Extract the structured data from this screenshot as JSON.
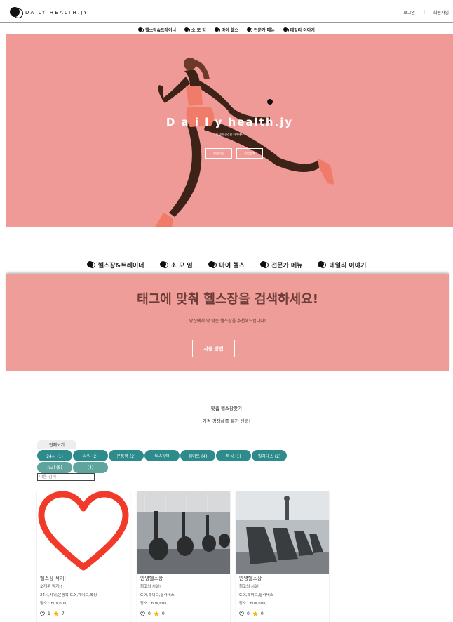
{
  "header": {
    "logo_text": "DAILY HEALTH.JY",
    "login": "로그인",
    "separator": "|",
    "signup": "회원가입"
  },
  "nav": {
    "items": [
      {
        "label": "헬스장&트레이너"
      },
      {
        "label": "소 모 임"
      },
      {
        "label": "마이 헬스"
      },
      {
        "label": "전문가 메뉴"
      },
      {
        "label": "데일리 이야기"
      }
    ]
  },
  "hero": {
    "title": "D a i l y health.jy",
    "subtitle": "일상에 건강을 더하세요",
    "buttons": [
      "회원가입",
      "사업등록"
    ]
  },
  "banner": {
    "title": "태그에 맞춰 헬스장을 검색하세요!",
    "subtitle": "당신에게 딱 맞는 헬스장을 추천해드립니다!",
    "button": "사용 방법"
  },
  "section": {
    "title": "맞춤 헬스장찾기",
    "subtitle": "가격 경쟁체를 통한 신뢰!"
  },
  "tags": {
    "all_tab": "전체보기",
    "row1": [
      "24시 (1)",
      "샤워 (2)",
      "운동복 (2)",
      "G.X (4)",
      "웨이트 (4)",
      "복싱 (1)",
      "필라테스 (2)"
    ],
    "row2": [
      "null (8)",
      "(4)"
    ],
    "search_placeholder": "이름 검색"
  },
  "cards": [
    {
      "title": "헬스장 적기!!",
      "intro": "소개문 적기!!",
      "tags": "24시,샤워,운동복,G.X,웨이트,복싱",
      "location": "장소 : null,null,",
      "hearts": "1",
      "stars": "7"
    },
    {
      "title": "안녕헬스장",
      "intro": "최고의 시설!",
      "tags": "G.X,웨이트,필라테스",
      "location": "장소 : null,null,",
      "hearts": "0",
      "stars": "0"
    },
    {
      "title": "안녕헬스장",
      "intro": "최고의 시설!",
      "tags": "G.X,웨이트,필라테스",
      "location": "장소 : null,null,",
      "hearts": "0",
      "stars": "0"
    }
  ],
  "colors": {
    "hero_bg": "#ef9a96",
    "tag_teal": "#2e8b8b",
    "heart_red": "#f23a2a"
  }
}
